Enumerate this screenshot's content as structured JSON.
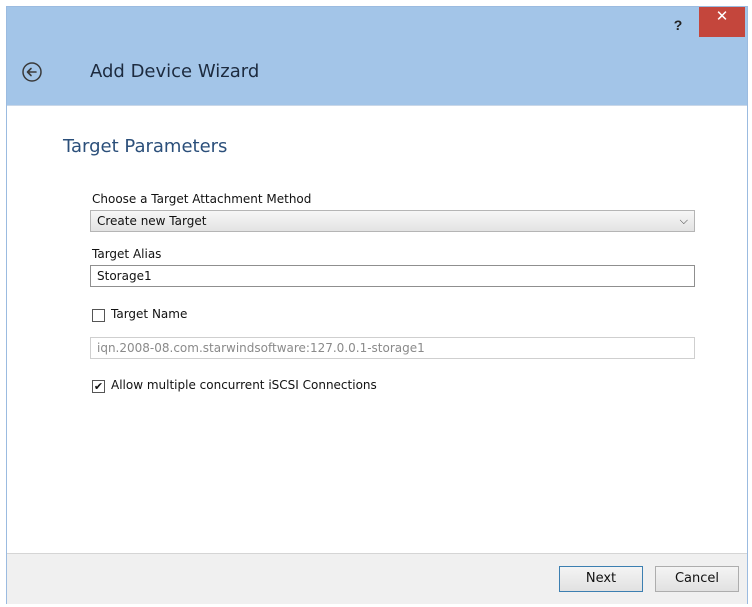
{
  "window": {
    "help_label": "?",
    "close_label": "✕",
    "title": "Add Device Wizard"
  },
  "page": {
    "title": "Target Parameters"
  },
  "form": {
    "attach_method_label": "Choose a Target Attachment Method",
    "attach_method_value": "Create new Target",
    "alias_label": "Target Alias",
    "alias_value": "Storage1",
    "target_name_checked": false,
    "target_name_label": "Target Name",
    "target_name_value": "iqn.2008-08.com.starwindsoftware:127.0.0.1-storage1",
    "multi_conn_checked": true,
    "multi_conn_label": "Allow multiple concurrent iSCSI Connections"
  },
  "footer": {
    "next_label": "Next",
    "cancel_label": "Cancel"
  },
  "icons": {
    "back": "back-arrow-icon",
    "dropdown": "chevron-down-icon",
    "close": "close-icon"
  }
}
